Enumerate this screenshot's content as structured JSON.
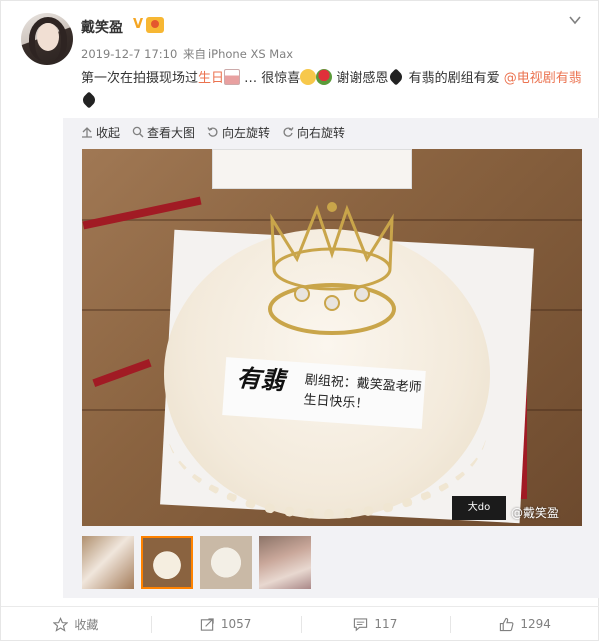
{
  "post": {
    "author": "戴笑盈",
    "timestamp": "2019-12-7 17:10",
    "source_prefix": "来自",
    "source": "iPhone XS Max",
    "text_part1": "第一次在拍摄现场过",
    "text_highlight1": "生日",
    "text_part2": " … 很惊喜",
    "text_part3": " 谢谢感恩",
    "text_part4": " 有翡的剧组有爱 ",
    "text_mention": "@电视剧有翡",
    "verified_icon": "V",
    "colors": {
      "accent": "#eb7350",
      "active": "#ff8200",
      "muted": "#808080"
    }
  },
  "toolbar": {
    "collapse": "收起",
    "view_large": "查看大图",
    "rotate_left": "向左旋转",
    "rotate_right": "向右旋转"
  },
  "photo": {
    "tag_brand": "有翡",
    "tag_line1": "剧组祝：戴笑盈老师",
    "tag_line2": "生日快乐！",
    "logo_text": "大do",
    "watermark": "@戴笑盈"
  },
  "thumbnails": {
    "count": 4,
    "selected_index": 1
  },
  "actions": {
    "favorite": "收藏",
    "repost": "1057",
    "comment": "117",
    "like": "1294"
  }
}
